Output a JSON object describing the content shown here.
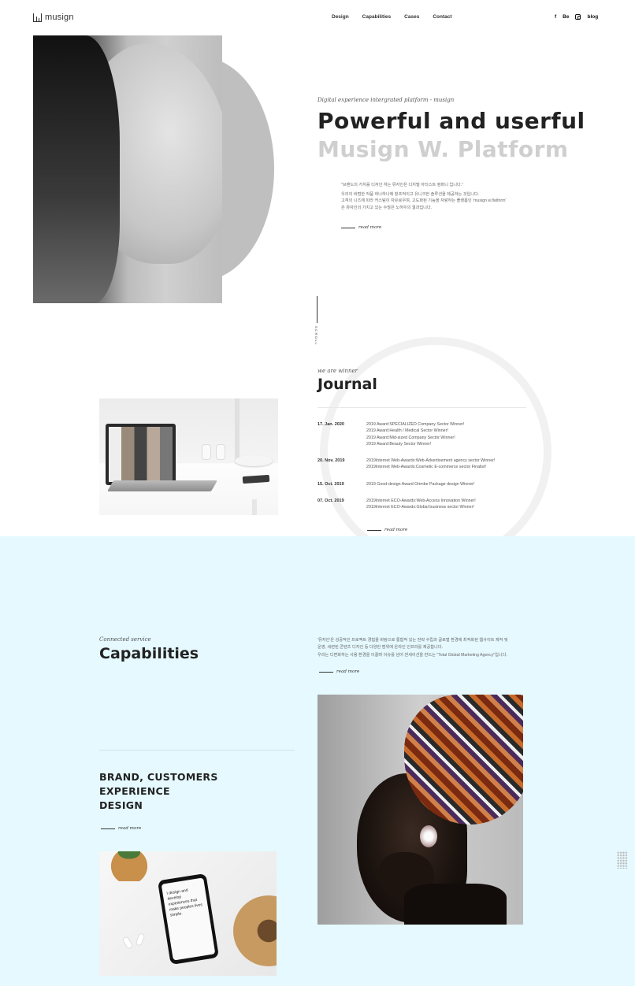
{
  "header": {
    "logo_text": "musign",
    "nav": [
      "Design",
      "Capabilities",
      "Cases",
      "Contact"
    ],
    "social": {
      "facebook": "f",
      "behance": "Be",
      "instagram_icon": "instagram-icon",
      "blog": "blog"
    }
  },
  "hero": {
    "subtitle": "Digital experience intergrated platform - musign",
    "title_line1": "Powerful and userful",
    "title_line2": "Musign W. Platform",
    "desc_quote": "\"브랜드의 가치를 디자인 하는 뮤자인은 디지털 아티스트 컴퍼니 입니다.\"",
    "desc_line1": "우리의 비범한 작품 하나하나에 창조적이고 유니크한 솔루션을 제공하는 것입니다.",
    "desc_line2": "고객의 니즈에 따라 커스텀이 자유로우며, 고도화된 기능을 자랑하는 플랫폼인 'musign w.flatform'",
    "desc_line3": "은 뮤자인의 가치고 있는 수많은 노하우의 결과입니다.",
    "read_more": "read more",
    "scroll": "SCROLL"
  },
  "journal": {
    "subtitle": "we are winner",
    "title": "Journal",
    "entries": [
      {
        "date": "17. Jan. 2020",
        "items": [
          "2019 Award:SPECIALIZED Company Sector Winner!",
          "2019 Award:Health / Medical Sector Winner!",
          "2019 Award:Mid-sized Company Sector Winner!",
          "2019 Award:Beauty Sector Winner!"
        ]
      },
      {
        "date": "20. Nov. 2019",
        "items": [
          "2019Internet Web-Awards:Web-Advertisement agency sector Winner!",
          "2019Internet Web-Awards:Cosmetic E-commerce sector Finalist!"
        ]
      },
      {
        "date": "15. Oct. 2019",
        "items": [
          "2019 Good-design Award Orimbe Package design Winner!"
        ]
      },
      {
        "date": "07. Oct. 2019",
        "items": [
          "2019Internet ECO-Awards:Web-Access Innovation Winner!",
          "2019Internet ECO-Awards:Global business sector Winner!"
        ]
      }
    ],
    "read_more": "read more"
  },
  "capabilities": {
    "subtitle": "Connected service",
    "title": "Capabilities",
    "desc_line1": "'뮤자인'은 성공적인 프로젝트 경험을 바탕으로 통합적 있는 전략 수립과 글로벌 환경에 최적화된 웹사이트 제작 및",
    "desc_line2": "운영, 세련된 콘텐츠 디자인 등 다양한 범위에 온라인 인프라를 제공합니다.",
    "desc_line3": "우리는 디변화하는 사용 환경을 이끌며 이슈를 넘어 센세이션을 만드는 \"Total Global Marketing Agency\"입니다.",
    "read_more": "read more",
    "heading_line1": "BRAND, CUSTOMERS",
    "heading_line2": "EXPERIENCE",
    "heading_line3": "DESIGN",
    "read_more2": "read more",
    "phone_screen_text": "I design and develop experiences that make peoples lives simple."
  },
  "colors": {
    "capabilities_bg": "#e5f9fe",
    "title_gray": "#cfcfcf",
    "text_dark": "#222222"
  }
}
